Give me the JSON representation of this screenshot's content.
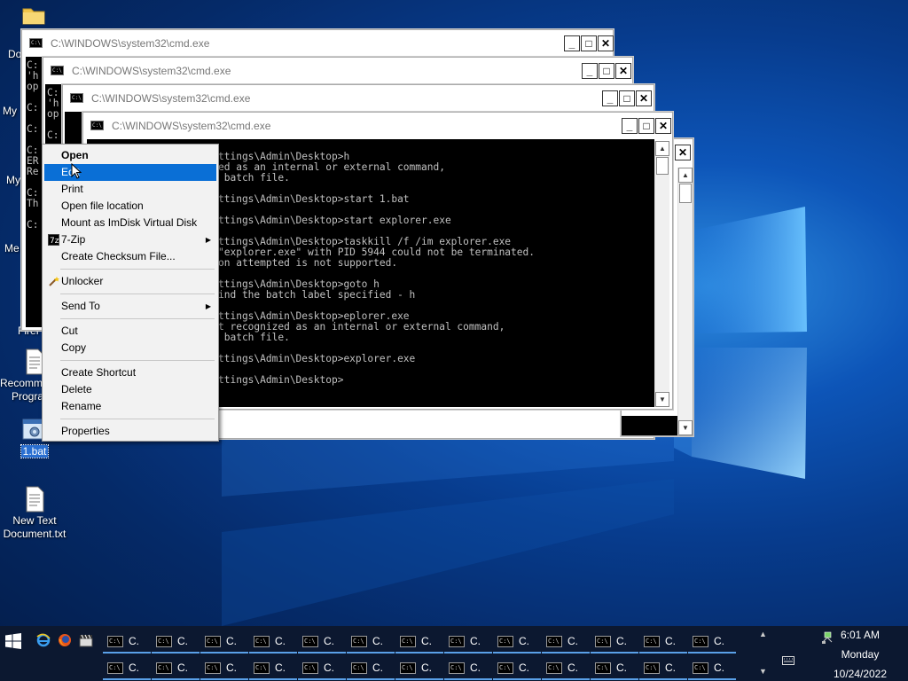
{
  "desktop": {
    "icons": [
      {
        "label": "New Text Document.txt"
      },
      {
        "label": "1.bat"
      },
      {
        "label": "Recommended Programs"
      }
    ],
    "clipped_labels": [
      "Do",
      "My",
      "My",
      "Me",
      "Firef"
    ]
  },
  "windows": {
    "title": "C:\\WINDOWS\\system32\\cmd.exe",
    "back_left_text": "C:\n'h\nop\n\nC:\n\nC:\n\nC:\nER\nRe\n\nC:\nTh\n\nC:",
    "back_mid_text": "C:\n'h\nop\n\nC:\n\nC:\nC:\n'h",
    "main_console": "ttings\\Admin\\Desktop>h\ned as an internal or external command,\n batch file.\n\nttings\\Admin\\Desktop>start 1.bat\n\nttings\\Admin\\Desktop>start explorer.exe\n\nttings\\Admin\\Desktop>taskkill /f /im explorer.exe\n\"explorer.exe\" with PID 5944 could not be terminated.\non attempted is not supported.\n\nttings\\Admin\\Desktop>goto h\nind the batch label specified - h\n\nttings\\Admin\\Desktop>eplorer.exe\nt recognized as an internal or external command,\n batch file.\n\nttings\\Admin\\Desktop>explorer.exe\n\nttings\\Admin\\Desktop>"
  },
  "context_menu": {
    "items": [
      {
        "label": "Open"
      },
      {
        "label": "Edit"
      },
      {
        "label": "Print"
      },
      {
        "label": "Open file location"
      },
      {
        "label": "Mount as ImDisk Virtual Disk"
      },
      {
        "label": "7-Zip"
      },
      {
        "label": "Create Checksum File..."
      },
      {
        "label": "Unlocker"
      },
      {
        "label": "Send To"
      },
      {
        "label": "Cut"
      },
      {
        "label": "Copy"
      },
      {
        "label": "Create Shortcut"
      },
      {
        "label": "Delete"
      },
      {
        "label": "Rename"
      },
      {
        "label": "Properties"
      }
    ]
  },
  "taskbar": {
    "item_label": "C.",
    "clock": {
      "time": "6:01 AM",
      "day": "Monday",
      "date": "10/24/2022"
    }
  },
  "colors": {
    "accent": "#0a6fd6",
    "taskbar": "#0c1830"
  }
}
